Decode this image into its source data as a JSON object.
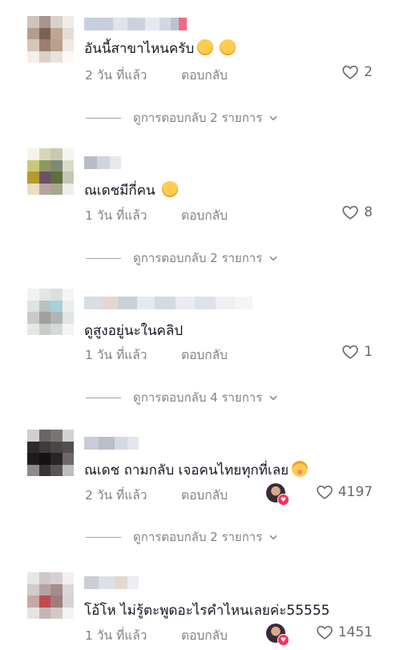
{
  "comments": [
    {
      "text": "อันนี้สาขาไหนครับ",
      "emojis": [
        "grinning-face-icon",
        "grinning-face-icon"
      ],
      "time": "2 วัน ที่แล้ว",
      "reply_label": "ตอบกลับ",
      "likes": "2",
      "view_replies": "ดูการตอบกลับ 2 รายการ",
      "creator_liked": false
    },
    {
      "text": "ณเดชมีกี่คน",
      "emojis": [
        "grinning-face-icon"
      ],
      "time": "1 วัน ที่แล้ว",
      "reply_label": "ตอบกลับ",
      "likes": "8",
      "view_replies": "ดูการตอบกลับ 2 รายการ",
      "creator_liked": false
    },
    {
      "text": "ดูสูงอยู่นะในคลิป",
      "emojis": [],
      "time": "1 วัน ที่แล้ว",
      "reply_label": "ตอบกลับ",
      "likes": "1",
      "view_replies": "ดูการตอบกลับ 4 รายการ",
      "creator_liked": false
    },
    {
      "text": "ณเดช ถามกลับ เจอคนไทยทุกที่เลย",
      "emojis": [
        "flushed-face-icon"
      ],
      "time": "2 วัน ที่แล้ว",
      "reply_label": "ตอบกลับ",
      "likes": "4197",
      "view_replies": "ดูการตอบกลับ 2 รายการ",
      "creator_liked": true
    },
    {
      "text": "โอ้โห ไม่รู้ตะพูดอะไรคำไหนเลยค่ะ55555",
      "emojis": [],
      "time": "1 วัน ที่แล้ว",
      "reply_label": "ตอบกลับ",
      "likes": "1451",
      "view_replies": "",
      "creator_liked": true
    }
  ],
  "colors": {
    "text": "#161823",
    "muted": "rgba(22,24,35,0.55)",
    "like_badge": "#fe2c55"
  }
}
